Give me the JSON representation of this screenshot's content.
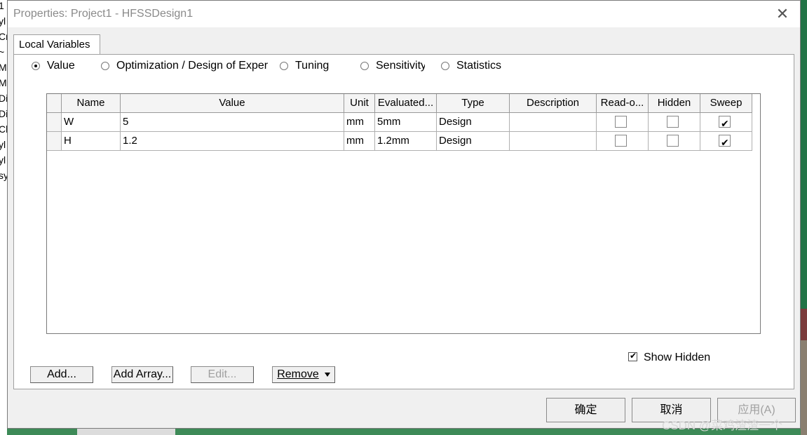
{
  "background": {
    "left_fragments": [
      "1",
      "yl",
      "Cr",
      "~",
      "M",
      "M",
      "Di",
      "Di",
      "Cl",
      "yl",
      "yl",
      "sy"
    ]
  },
  "dialog": {
    "title": "Properties: Project1 - HFSSDesign1",
    "close_icon": "close-icon",
    "tab_label": "Local Variables",
    "radio_options": [
      {
        "label": "Value",
        "selected": true
      },
      {
        "label": "Optimization / Design of Exper",
        "selected": false
      },
      {
        "label": "Tuning",
        "selected": false
      },
      {
        "label": "Sensitivity",
        "selected": false
      },
      {
        "label": "Statistics",
        "selected": false
      }
    ],
    "table": {
      "columns": [
        "Name",
        "Value",
        "Unit",
        "Evaluated...",
        "Type",
        "Description",
        "Read-o...",
        "Hidden",
        "Sweep"
      ],
      "rows": [
        {
          "name": "W",
          "value": "5",
          "unit": "mm",
          "evaluated": "5mm",
          "type": "Design",
          "description": "",
          "readonly": false,
          "hidden": false,
          "sweep": true
        },
        {
          "name": "H",
          "value": "1.2",
          "unit": "mm",
          "evaluated": "1.2mm",
          "type": "Design",
          "description": "",
          "readonly": false,
          "hidden": false,
          "sweep": true
        }
      ]
    },
    "show_hidden": {
      "label": "Show Hidden",
      "checked": true
    },
    "buttons": {
      "add": "Add...",
      "add_array": "Add Array...",
      "edit": "Edit...",
      "remove": "Remove",
      "ok": "确定",
      "cancel": "取消",
      "apply": "应用(A)"
    },
    "colors": {
      "selected_check": "#000000",
      "disabled_text": "#a0a0a0"
    }
  },
  "watermark": "CSDN @菜鸡渣渣一个"
}
